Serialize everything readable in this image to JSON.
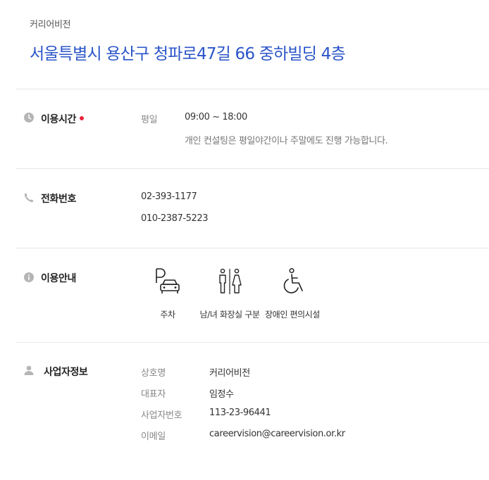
{
  "header": {
    "business_name": "커리어비전",
    "address": "서울특별시 용산구 청파로47길 66 중하빌딩 4층"
  },
  "hours": {
    "title": "이용시간",
    "icon": "clock-icon",
    "day_label": "평일",
    "time": "09:00 ~ 18:00",
    "note": "개인 컨설팅은 평일야간이나 주말에도 진행 가능합니다."
  },
  "phone": {
    "title": "전화번호",
    "icon": "phone-icon",
    "numbers": [
      "02-393-1177",
      "010-2387-5223"
    ]
  },
  "facilities": {
    "title": "이용안내",
    "icon": "info-icon",
    "items": [
      {
        "label": "주차",
        "icon": "parking-icon"
      },
      {
        "label": "남/녀 화장실 구분",
        "icon": "restroom-icon"
      },
      {
        "label": "장애인 편의시설",
        "icon": "wheelchair-icon"
      }
    ]
  },
  "business_info": {
    "title": "사업자정보",
    "icon": "user-icon",
    "rows": [
      {
        "label": "상호명",
        "value": "커리어비전"
      },
      {
        "label": "대표자",
        "value": "임정수"
      },
      {
        "label": "사업자번호",
        "value": "113-23-96441"
      },
      {
        "label": "이메일",
        "value": "careervision@careervision.or.kr"
      }
    ]
  },
  "colors": {
    "accent": "#2b55c9",
    "dot": "#e8243c",
    "icon_gray": "#b5b5b5"
  }
}
